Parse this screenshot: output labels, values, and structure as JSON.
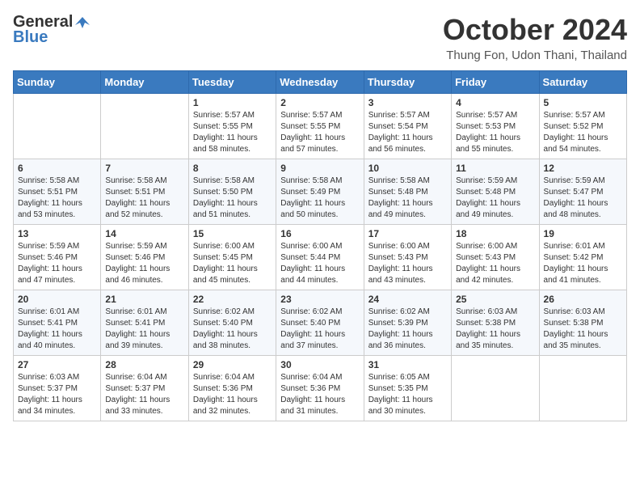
{
  "header": {
    "logo_general": "General",
    "logo_blue": "Blue",
    "month_title": "October 2024",
    "location": "Thung Fon, Udon Thani, Thailand"
  },
  "weekdays": [
    "Sunday",
    "Monday",
    "Tuesday",
    "Wednesday",
    "Thursday",
    "Friday",
    "Saturday"
  ],
  "weeks": [
    [
      {
        "day": "",
        "content": ""
      },
      {
        "day": "",
        "content": ""
      },
      {
        "day": "1",
        "content": "Sunrise: 5:57 AM\nSunset: 5:55 PM\nDaylight: 11 hours and 58 minutes."
      },
      {
        "day": "2",
        "content": "Sunrise: 5:57 AM\nSunset: 5:55 PM\nDaylight: 11 hours and 57 minutes."
      },
      {
        "day": "3",
        "content": "Sunrise: 5:57 AM\nSunset: 5:54 PM\nDaylight: 11 hours and 56 minutes."
      },
      {
        "day": "4",
        "content": "Sunrise: 5:57 AM\nSunset: 5:53 PM\nDaylight: 11 hours and 55 minutes."
      },
      {
        "day": "5",
        "content": "Sunrise: 5:57 AM\nSunset: 5:52 PM\nDaylight: 11 hours and 54 minutes."
      }
    ],
    [
      {
        "day": "6",
        "content": "Sunrise: 5:58 AM\nSunset: 5:51 PM\nDaylight: 11 hours and 53 minutes."
      },
      {
        "day": "7",
        "content": "Sunrise: 5:58 AM\nSunset: 5:51 PM\nDaylight: 11 hours and 52 minutes."
      },
      {
        "day": "8",
        "content": "Sunrise: 5:58 AM\nSunset: 5:50 PM\nDaylight: 11 hours and 51 minutes."
      },
      {
        "day": "9",
        "content": "Sunrise: 5:58 AM\nSunset: 5:49 PM\nDaylight: 11 hours and 50 minutes."
      },
      {
        "day": "10",
        "content": "Sunrise: 5:58 AM\nSunset: 5:48 PM\nDaylight: 11 hours and 49 minutes."
      },
      {
        "day": "11",
        "content": "Sunrise: 5:59 AM\nSunset: 5:48 PM\nDaylight: 11 hours and 49 minutes."
      },
      {
        "day": "12",
        "content": "Sunrise: 5:59 AM\nSunset: 5:47 PM\nDaylight: 11 hours and 48 minutes."
      }
    ],
    [
      {
        "day": "13",
        "content": "Sunrise: 5:59 AM\nSunset: 5:46 PM\nDaylight: 11 hours and 47 minutes."
      },
      {
        "day": "14",
        "content": "Sunrise: 5:59 AM\nSunset: 5:46 PM\nDaylight: 11 hours and 46 minutes."
      },
      {
        "day": "15",
        "content": "Sunrise: 6:00 AM\nSunset: 5:45 PM\nDaylight: 11 hours and 45 minutes."
      },
      {
        "day": "16",
        "content": "Sunrise: 6:00 AM\nSunset: 5:44 PM\nDaylight: 11 hours and 44 minutes."
      },
      {
        "day": "17",
        "content": "Sunrise: 6:00 AM\nSunset: 5:43 PM\nDaylight: 11 hours and 43 minutes."
      },
      {
        "day": "18",
        "content": "Sunrise: 6:00 AM\nSunset: 5:43 PM\nDaylight: 11 hours and 42 minutes."
      },
      {
        "day": "19",
        "content": "Sunrise: 6:01 AM\nSunset: 5:42 PM\nDaylight: 11 hours and 41 minutes."
      }
    ],
    [
      {
        "day": "20",
        "content": "Sunrise: 6:01 AM\nSunset: 5:41 PM\nDaylight: 11 hours and 40 minutes."
      },
      {
        "day": "21",
        "content": "Sunrise: 6:01 AM\nSunset: 5:41 PM\nDaylight: 11 hours and 39 minutes."
      },
      {
        "day": "22",
        "content": "Sunrise: 6:02 AM\nSunset: 5:40 PM\nDaylight: 11 hours and 38 minutes."
      },
      {
        "day": "23",
        "content": "Sunrise: 6:02 AM\nSunset: 5:40 PM\nDaylight: 11 hours and 37 minutes."
      },
      {
        "day": "24",
        "content": "Sunrise: 6:02 AM\nSunset: 5:39 PM\nDaylight: 11 hours and 36 minutes."
      },
      {
        "day": "25",
        "content": "Sunrise: 6:03 AM\nSunset: 5:38 PM\nDaylight: 11 hours and 35 minutes."
      },
      {
        "day": "26",
        "content": "Sunrise: 6:03 AM\nSunset: 5:38 PM\nDaylight: 11 hours and 35 minutes."
      }
    ],
    [
      {
        "day": "27",
        "content": "Sunrise: 6:03 AM\nSunset: 5:37 PM\nDaylight: 11 hours and 34 minutes."
      },
      {
        "day": "28",
        "content": "Sunrise: 6:04 AM\nSunset: 5:37 PM\nDaylight: 11 hours and 33 minutes."
      },
      {
        "day": "29",
        "content": "Sunrise: 6:04 AM\nSunset: 5:36 PM\nDaylight: 11 hours and 32 minutes."
      },
      {
        "day": "30",
        "content": "Sunrise: 6:04 AM\nSunset: 5:36 PM\nDaylight: 11 hours and 31 minutes."
      },
      {
        "day": "31",
        "content": "Sunrise: 6:05 AM\nSunset: 5:35 PM\nDaylight: 11 hours and 30 minutes."
      },
      {
        "day": "",
        "content": ""
      },
      {
        "day": "",
        "content": ""
      }
    ]
  ]
}
